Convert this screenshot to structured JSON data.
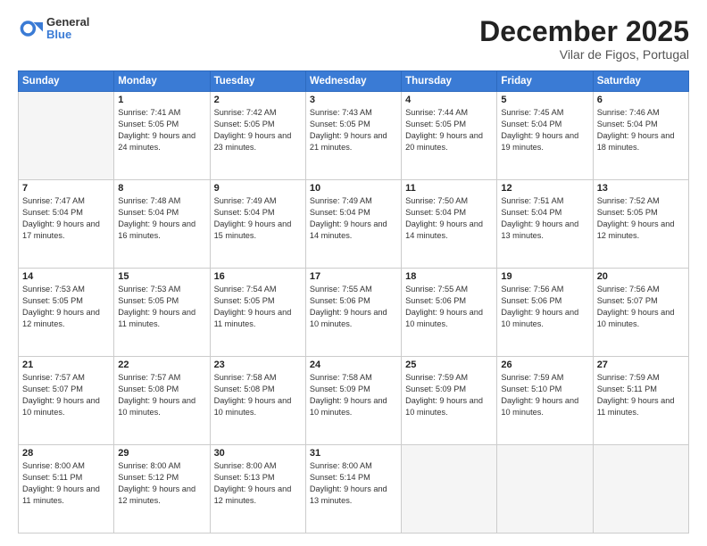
{
  "header": {
    "logo_general": "General",
    "logo_blue": "Blue",
    "month": "December 2025",
    "location": "Vilar de Figos, Portugal"
  },
  "weekdays": [
    "Sunday",
    "Monday",
    "Tuesday",
    "Wednesday",
    "Thursday",
    "Friday",
    "Saturday"
  ],
  "weeks": [
    [
      {
        "day": "",
        "sunrise": "",
        "sunset": "",
        "daylight": ""
      },
      {
        "day": "1",
        "sunrise": "7:41 AM",
        "sunset": "5:05 PM",
        "daylight": "9 hours and 24 minutes."
      },
      {
        "day": "2",
        "sunrise": "7:42 AM",
        "sunset": "5:05 PM",
        "daylight": "9 hours and 23 minutes."
      },
      {
        "day": "3",
        "sunrise": "7:43 AM",
        "sunset": "5:05 PM",
        "daylight": "9 hours and 21 minutes."
      },
      {
        "day": "4",
        "sunrise": "7:44 AM",
        "sunset": "5:05 PM",
        "daylight": "9 hours and 20 minutes."
      },
      {
        "day": "5",
        "sunrise": "7:45 AM",
        "sunset": "5:04 PM",
        "daylight": "9 hours and 19 minutes."
      },
      {
        "day": "6",
        "sunrise": "7:46 AM",
        "sunset": "5:04 PM",
        "daylight": "9 hours and 18 minutes."
      }
    ],
    [
      {
        "day": "7",
        "sunrise": "7:47 AM",
        "sunset": "5:04 PM",
        "daylight": "9 hours and 17 minutes."
      },
      {
        "day": "8",
        "sunrise": "7:48 AM",
        "sunset": "5:04 PM",
        "daylight": "9 hours and 16 minutes."
      },
      {
        "day": "9",
        "sunrise": "7:49 AM",
        "sunset": "5:04 PM",
        "daylight": "9 hours and 15 minutes."
      },
      {
        "day": "10",
        "sunrise": "7:49 AM",
        "sunset": "5:04 PM",
        "daylight": "9 hours and 14 minutes."
      },
      {
        "day": "11",
        "sunrise": "7:50 AM",
        "sunset": "5:04 PM",
        "daylight": "9 hours and 14 minutes."
      },
      {
        "day": "12",
        "sunrise": "7:51 AM",
        "sunset": "5:04 PM",
        "daylight": "9 hours and 13 minutes."
      },
      {
        "day": "13",
        "sunrise": "7:52 AM",
        "sunset": "5:05 PM",
        "daylight": "9 hours and 12 minutes."
      }
    ],
    [
      {
        "day": "14",
        "sunrise": "7:53 AM",
        "sunset": "5:05 PM",
        "daylight": "9 hours and 12 minutes."
      },
      {
        "day": "15",
        "sunrise": "7:53 AM",
        "sunset": "5:05 PM",
        "daylight": "9 hours and 11 minutes."
      },
      {
        "day": "16",
        "sunrise": "7:54 AM",
        "sunset": "5:05 PM",
        "daylight": "9 hours and 11 minutes."
      },
      {
        "day": "17",
        "sunrise": "7:55 AM",
        "sunset": "5:06 PM",
        "daylight": "9 hours and 10 minutes."
      },
      {
        "day": "18",
        "sunrise": "7:55 AM",
        "sunset": "5:06 PM",
        "daylight": "9 hours and 10 minutes."
      },
      {
        "day": "19",
        "sunrise": "7:56 AM",
        "sunset": "5:06 PM",
        "daylight": "9 hours and 10 minutes."
      },
      {
        "day": "20",
        "sunrise": "7:56 AM",
        "sunset": "5:07 PM",
        "daylight": "9 hours and 10 minutes."
      }
    ],
    [
      {
        "day": "21",
        "sunrise": "7:57 AM",
        "sunset": "5:07 PM",
        "daylight": "9 hours and 10 minutes."
      },
      {
        "day": "22",
        "sunrise": "7:57 AM",
        "sunset": "5:08 PM",
        "daylight": "9 hours and 10 minutes."
      },
      {
        "day": "23",
        "sunrise": "7:58 AM",
        "sunset": "5:08 PM",
        "daylight": "9 hours and 10 minutes."
      },
      {
        "day": "24",
        "sunrise": "7:58 AM",
        "sunset": "5:09 PM",
        "daylight": "9 hours and 10 minutes."
      },
      {
        "day": "25",
        "sunrise": "7:59 AM",
        "sunset": "5:09 PM",
        "daylight": "9 hours and 10 minutes."
      },
      {
        "day": "26",
        "sunrise": "7:59 AM",
        "sunset": "5:10 PM",
        "daylight": "9 hours and 10 minutes."
      },
      {
        "day": "27",
        "sunrise": "7:59 AM",
        "sunset": "5:11 PM",
        "daylight": "9 hours and 11 minutes."
      }
    ],
    [
      {
        "day": "28",
        "sunrise": "8:00 AM",
        "sunset": "5:11 PM",
        "daylight": "9 hours and 11 minutes."
      },
      {
        "day": "29",
        "sunrise": "8:00 AM",
        "sunset": "5:12 PM",
        "daylight": "9 hours and 12 minutes."
      },
      {
        "day": "30",
        "sunrise": "8:00 AM",
        "sunset": "5:13 PM",
        "daylight": "9 hours and 12 minutes."
      },
      {
        "day": "31",
        "sunrise": "8:00 AM",
        "sunset": "5:14 PM",
        "daylight": "9 hours and 13 minutes."
      },
      {
        "day": "",
        "sunrise": "",
        "sunset": "",
        "daylight": ""
      },
      {
        "day": "",
        "sunrise": "",
        "sunset": "",
        "daylight": ""
      },
      {
        "day": "",
        "sunrise": "",
        "sunset": "",
        "daylight": ""
      }
    ]
  ]
}
